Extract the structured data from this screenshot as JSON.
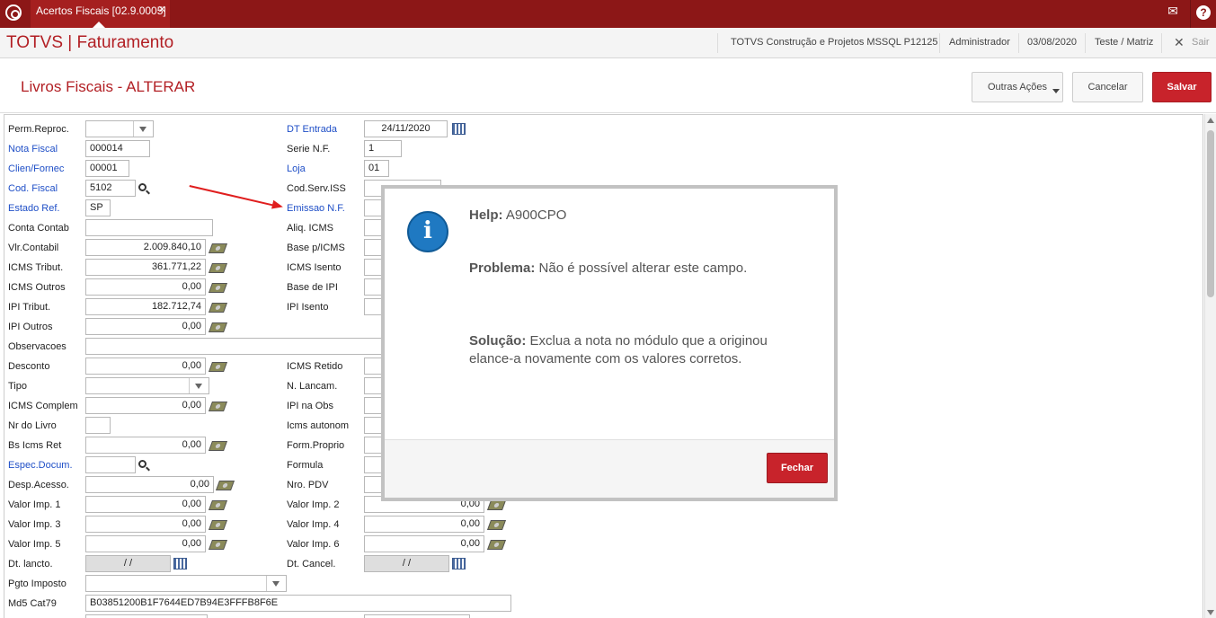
{
  "topbar": {
    "tab_label": "Acertos Fiscais [02.9.0005]",
    "tab_close": "✕",
    "mail_icon": "✉",
    "help_icon": "?"
  },
  "header": {
    "app_title": "TOTVS | Faturamento",
    "environment": "TOTVS Construção e Projetos MSSQL P12125",
    "user": "Administrador",
    "date": "03/08/2020",
    "branch": "Teste / Matriz",
    "exit_label": "Sair",
    "exit_icon": "✕"
  },
  "page": {
    "title": "Livros Fiscais - ALTERAR",
    "buttons": {
      "outras": "Outras Ações",
      "cancelar": "Cancelar",
      "salvar": "Salvar"
    }
  },
  "fields_left": [
    {
      "label": "Perm.Reproc.",
      "value": "",
      "required": false
    },
    {
      "label": "Nota Fiscal",
      "value": "000014",
      "required": true
    },
    {
      "label": "Clien/Fornec",
      "value": "00001",
      "required": true
    },
    {
      "label": "Cod. Fiscal",
      "value": "5102",
      "required": true
    },
    {
      "label": "Estado Ref.",
      "value": "SP",
      "required": true
    },
    {
      "label": "Conta Contab",
      "value": "",
      "required": false
    },
    {
      "label": "Vlr.Contabil",
      "value": "2.009.840,10",
      "required": false
    },
    {
      "label": "ICMS Tribut.",
      "value": "361.771,22",
      "required": false
    },
    {
      "label": "ICMS Outros",
      "value": "0,00",
      "required": false
    },
    {
      "label": "IPI Tribut.",
      "value": "182.712,74",
      "required": false
    },
    {
      "label": "IPI Outros",
      "value": "0,00",
      "required": false
    },
    {
      "label": "Observacoes",
      "value": "",
      "required": false
    },
    {
      "label": "Desconto",
      "value": "0,00",
      "required": false
    },
    {
      "label": "Tipo",
      "value": "",
      "required": false
    },
    {
      "label": "ICMS Complem",
      "value": "0,00",
      "required": false
    },
    {
      "label": "Nr do Livro",
      "value": "",
      "required": false
    },
    {
      "label": "Bs Icms Ret",
      "value": "0,00",
      "required": false
    },
    {
      "label": "Espec.Docum.",
      "value": "",
      "required": true
    },
    {
      "label": "Desp.Acesso.",
      "value": "0,00",
      "required": false
    },
    {
      "label": "Valor Imp. 1",
      "value": "0,00",
      "required": false
    },
    {
      "label": "Valor Imp. 3",
      "value": "0,00",
      "required": false
    },
    {
      "label": "Valor Imp. 5",
      "value": "0,00",
      "required": false
    },
    {
      "label": "Dt. lancto.",
      "value": " / /",
      "required": false
    },
    {
      "label": "Pgto Imposto",
      "value": "",
      "required": false
    },
    {
      "label": "Md5 Cat79",
      "value": "B03851200B1F7644ED7B94E3FFFB8F6E",
      "required": false
    }
  ],
  "fields_right": [
    {
      "label": "DT Entrada",
      "value": "24/11/2020",
      "required": true
    },
    {
      "label": "Serie N.F.",
      "value": "1",
      "required": false
    },
    {
      "label": "Loja",
      "value": "01",
      "required": true
    },
    {
      "label": "Cod.Serv.ISS",
      "value": "",
      "required": false
    },
    {
      "label": "Emissao N.F.",
      "value": "",
      "required": true
    },
    {
      "label": "Aliq. ICMS",
      "value": "",
      "required": false
    },
    {
      "label": "Base p/ICMS",
      "value": "",
      "required": false
    },
    {
      "label": "ICMS Isento",
      "value": "",
      "required": false
    },
    {
      "label": "Base de IPI",
      "value": "",
      "required": false
    },
    {
      "label": "IPI Isento",
      "value": "",
      "required": false
    },
    {
      "label": "ICMS Retido",
      "value": "",
      "required": false
    },
    {
      "label": "N. Lancam.",
      "value": "",
      "required": false
    },
    {
      "label": "IPI na Obs",
      "value": "",
      "required": false
    },
    {
      "label": "Icms autonom",
      "value": "",
      "required": false
    },
    {
      "label": "Form.Proprio",
      "value": "",
      "required": false
    },
    {
      "label": "Formula",
      "value": "",
      "required": false
    },
    {
      "label": "Nro. PDV",
      "value": "",
      "required": false
    },
    {
      "label": "Valor Imp. 2",
      "value": "0,00",
      "required": false
    },
    {
      "label": "Valor Imp. 4",
      "value": "0,00",
      "required": false
    },
    {
      "label": "Valor Imp. 6",
      "value": "0,00",
      "required": false
    },
    {
      "label": "Dt. Cancel.",
      "value": " / /",
      "required": false
    }
  ],
  "modal": {
    "help_label": "Help:",
    "help_code": "A900CPO",
    "problem_label": "Problema:",
    "problem_text": "Não é possível alterar este campo.",
    "solution_label": "Solução:",
    "solution_line1": "Exclua a nota no módulo que a originou",
    "solution_line2": "elance-a novamente com os valores corretos.",
    "close_label": "Fechar",
    "icon_glyph": "i"
  },
  "colors": {
    "topbar": "#8c1717",
    "accent": "#b21f24",
    "button_red": "#c8232b",
    "required_label": "#1f4fc7",
    "info_icon": "#1f79c2"
  }
}
